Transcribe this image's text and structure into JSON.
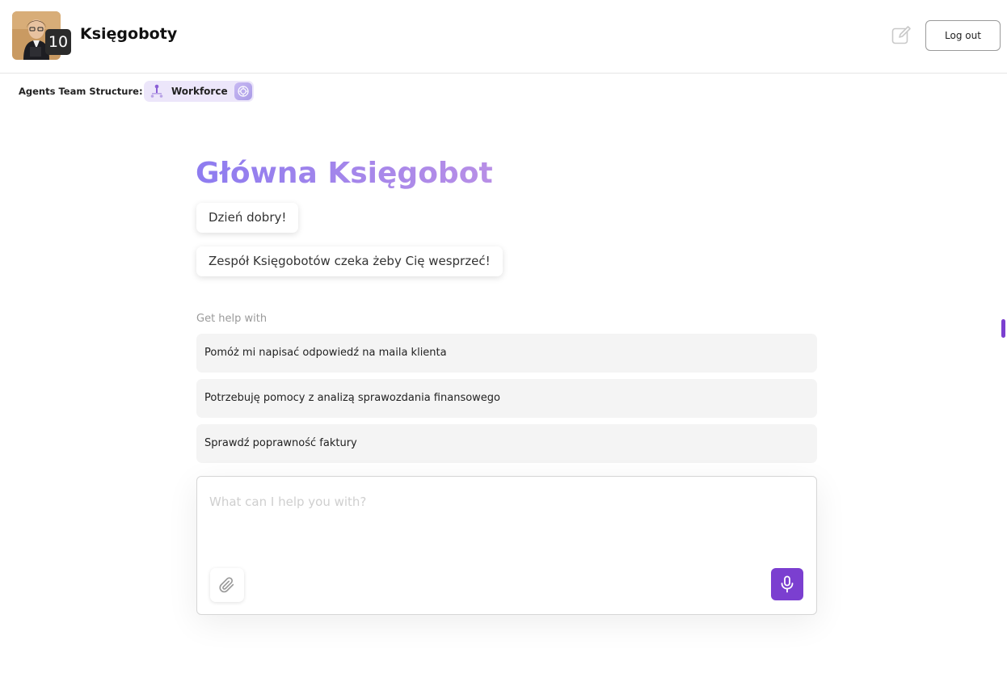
{
  "header": {
    "app_title": "Księgoboty",
    "avatar_badge": "10",
    "logout_label": "Log out",
    "icons": {
      "edit": "edit-icon",
      "avatar": "avatar-photo"
    }
  },
  "team_structure": {
    "label": "Agents Team Structure:",
    "chip_label": "Workforce",
    "chip_icons": [
      "team-hierarchy-icon",
      "openai-icon"
    ]
  },
  "agent": {
    "title": "Główna Księgobot",
    "messages": [
      "Dzień dobry!",
      "Zespół Księgobotów czeka żeby Cię wesprzeć!"
    ]
  },
  "help": {
    "label": "Get help with",
    "suggestions": [
      "Pomóż mi napisać odpowiedź na maila klienta",
      "Potrzebuję pomocy z analizą sprawozdania finansowego",
      "Sprawdź poprawność faktury"
    ]
  },
  "composer": {
    "placeholder": "What can I help you with?",
    "value": "",
    "icons": {
      "attach": "paperclip-icon",
      "mic": "microphone-icon"
    }
  },
  "colors": {
    "accent": "#7b3fd0",
    "title_gradient_start": "#8e7cf0",
    "title_gradient_end": "#b88fe6",
    "chip_bg": "#ece6fa",
    "suggestion_bg": "#f4f4f4"
  }
}
